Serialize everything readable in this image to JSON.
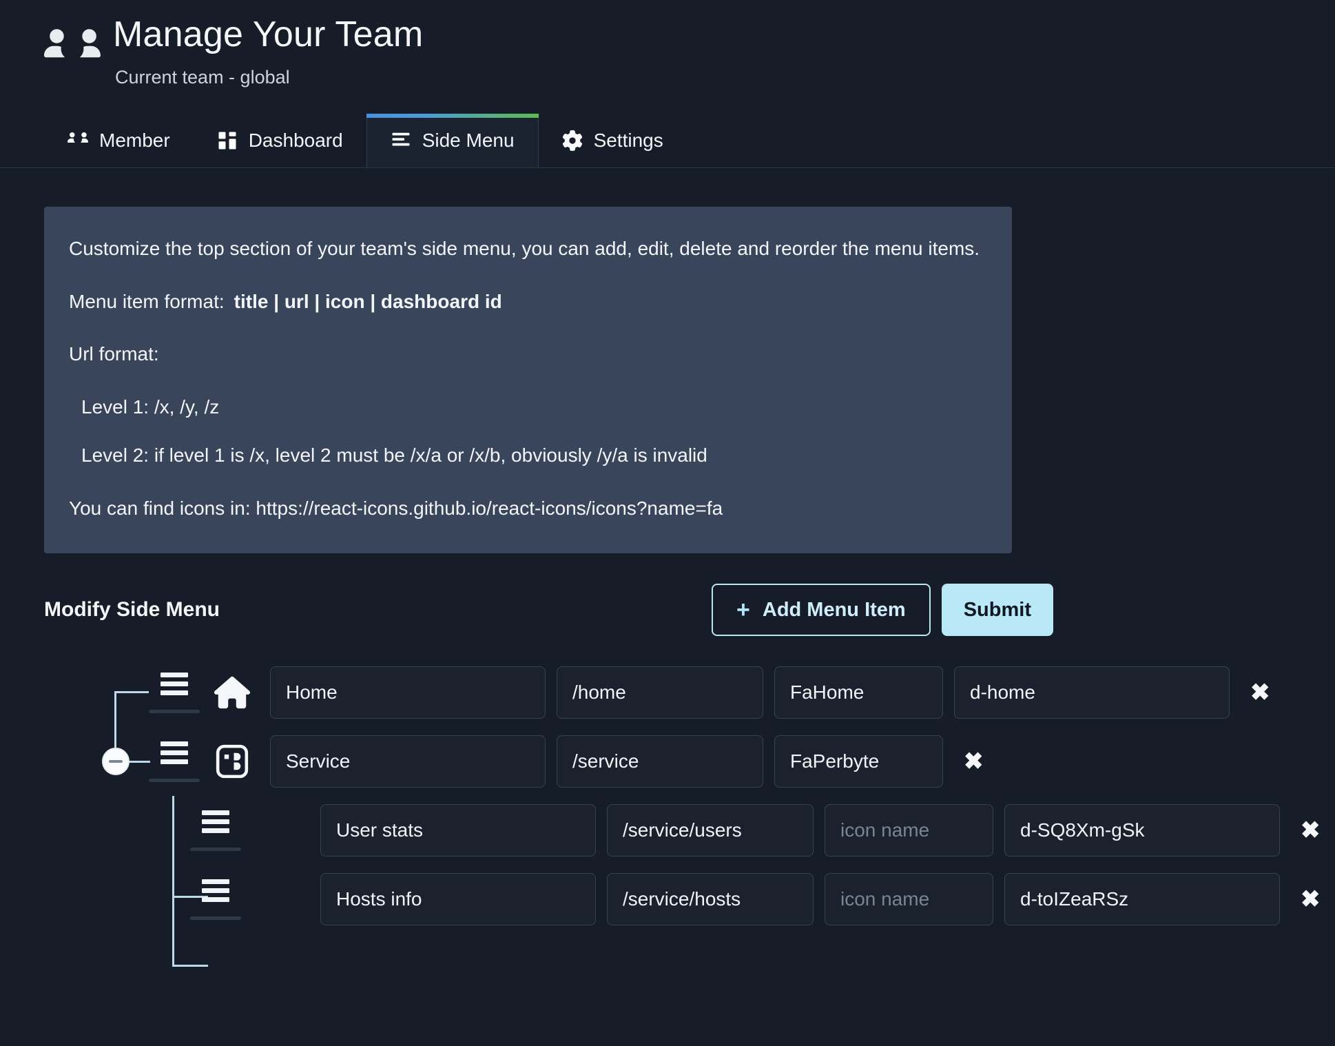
{
  "header": {
    "title": "Manage Your Team",
    "subtitle": "Current team - global",
    "icon": "users-icon"
  },
  "tabs": [
    {
      "label": "Member",
      "icon": "users-icon",
      "active": false
    },
    {
      "label": "Dashboard",
      "icon": "dashboard-icon",
      "active": false
    },
    {
      "label": "Side Menu",
      "icon": "list-icon",
      "active": true
    },
    {
      "label": "Settings",
      "icon": "gear-icon",
      "active": false
    }
  ],
  "info": {
    "description": "Customize the top section of your team's side menu, you can add, edit, delete and reorder the menu items.",
    "format_label": "Menu item format:",
    "format_value": "title | url | icon | dashboard id",
    "url_format_label": "Url format:",
    "level1": "Level 1: /x, /y, /z",
    "level2": "Level 2: if level 1 is /x, level 2 must be /x/a or /x/b, obviously /y/a is invalid",
    "icons_hint": "You can find icons in: https://react-icons.github.io/react-icons/icons?name=fa"
  },
  "modify": {
    "title": "Modify Side Menu",
    "add_label": "Add Menu Item",
    "add_plus": "+",
    "submit_label": "Submit",
    "delete_glyph": "✖"
  },
  "placeholders": {
    "icon_name": "icon name"
  },
  "menu_items": [
    {
      "title": "Home",
      "url": "/home",
      "icon": "FaHome",
      "dashboard_id": "d-home",
      "icon_glyph": "home-icon",
      "level": 1
    },
    {
      "title": "Service",
      "url": "/service",
      "icon": "FaPerbyte",
      "dashboard_id": "",
      "icon_glyph": "perbyte-icon",
      "level": 1
    },
    {
      "title": "User stats",
      "url": "/service/users",
      "icon": "",
      "dashboard_id": "d-SQ8Xm-gSk",
      "icon_glyph": "",
      "level": 2
    },
    {
      "title": "Hosts info",
      "url": "/service/hosts",
      "icon": "",
      "dashboard_id": "d-toIZeaRSz",
      "icon_glyph": "",
      "level": 2
    }
  ],
  "colors": {
    "background": "#171d28",
    "info_panel": "#39455a",
    "accent": "#b9e9f6",
    "tab_gradient_start": "#4a8fe0",
    "tab_gradient_end": "#5cbb52",
    "connector": "#bed9ea"
  }
}
